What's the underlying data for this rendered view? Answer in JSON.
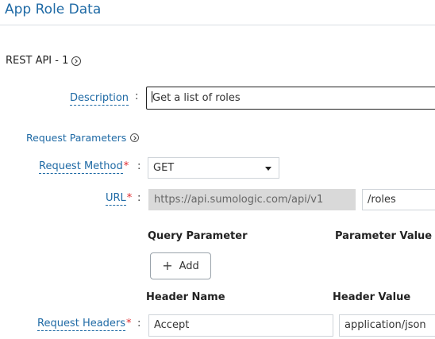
{
  "header": {
    "title": "App Role Data"
  },
  "api": {
    "title": "REST API - 1",
    "icon": "circle-chevron-right-icon"
  },
  "description": {
    "label": "Description",
    "colon": ":",
    "value": "Get a list of roles"
  },
  "request_parameters": {
    "label": "Request Parameters",
    "icon": "circle-chevron-right-icon"
  },
  "request_method": {
    "label": "Request Method",
    "required_mark": "*",
    "colon": ":",
    "value": "GET"
  },
  "url": {
    "label": "URL",
    "required_mark": "*",
    "colon": ":",
    "base": "https://api.sumologic.com/api/v1",
    "path": "/roles"
  },
  "query_parameters": {
    "col_name": "Query Parameter",
    "col_value": "Parameter Value",
    "add_label": "Add"
  },
  "request_headers": {
    "label": "Request Headers",
    "required_mark": "*",
    "colon": ":",
    "col_name": "Header Name",
    "col_value": "Header Value",
    "rows": [
      {
        "name": "Accept",
        "value": "application/json"
      }
    ]
  },
  "colors": {
    "accent": "#1f6aa5",
    "required": "#e0292c",
    "disabled_bg": "#d9d9d9"
  }
}
